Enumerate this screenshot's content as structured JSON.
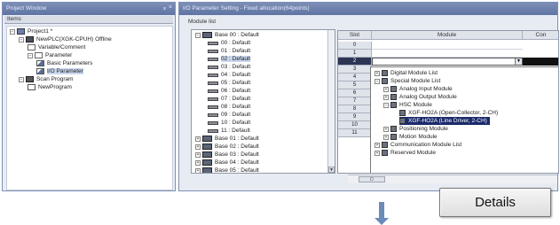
{
  "project_window": {
    "title": "Project Window",
    "pin": "ᵩ",
    "close": "×",
    "items_header": "Items",
    "tree": [
      {
        "label": "Project1 *",
        "indent": 0,
        "icon": "project",
        "expander": "−"
      },
      {
        "label": "NewPLC(XGK-CPUH) Offline",
        "indent": 1,
        "icon": "plc",
        "expander": "−"
      },
      {
        "label": "Variable/Comment",
        "indent": 2,
        "icon": "doc",
        "expander": ""
      },
      {
        "label": "Parameter",
        "indent": 2,
        "icon": "doc",
        "expander": "−"
      },
      {
        "label": "Basic Parameters",
        "indent": 3,
        "icon": "settings",
        "expander": ""
      },
      {
        "label": "I/O Parameter",
        "indent": 3,
        "icon": "settings",
        "expander": "",
        "selected": true
      },
      {
        "label": "Scan Program",
        "indent": 1,
        "icon": "scan",
        "expander": "−"
      },
      {
        "label": "NewProgram",
        "indent": 2,
        "icon": "program",
        "expander": ""
      }
    ]
  },
  "io_window": {
    "title": "I/O Parameter Setting - Fixed allocation(64points)",
    "module_list_label": "Module list",
    "base_tree": [
      {
        "label": "Base 00 : Default",
        "type": "base",
        "expander": "−"
      },
      {
        "label": "00 : Default",
        "type": "slot"
      },
      {
        "label": "01 : Default",
        "type": "slot"
      },
      {
        "label": "02 : Default",
        "type": "slot"
      },
      {
        "label": "03 : Default",
        "type": "slot"
      },
      {
        "label": "04 : Default",
        "type": "slot"
      },
      {
        "label": "05 : Default",
        "type": "slot"
      },
      {
        "label": "06 : Default",
        "type": "slot"
      },
      {
        "label": "07 : Default",
        "type": "slot"
      },
      {
        "label": "08 : Default",
        "type": "slot"
      },
      {
        "label": "09 : Default",
        "type": "slot"
      },
      {
        "label": "10 : Default",
        "type": "slot"
      },
      {
        "label": "11 : Default",
        "type": "slot"
      },
      {
        "label": "Base 01 : Default",
        "type": "base",
        "expander": "+"
      },
      {
        "label": "Base 02 : Default",
        "type": "base",
        "expander": "+"
      },
      {
        "label": "Base 03 : Default",
        "type": "base",
        "expander": "+"
      },
      {
        "label": "Base 04 : Default",
        "type": "base",
        "expander": "+"
      },
      {
        "label": "Base 05 : Default",
        "type": "base",
        "expander": "+"
      }
    ],
    "grid": {
      "headers": [
        "Slot",
        "Module",
        "Con"
      ],
      "slots": [
        "0",
        "1",
        "2",
        "3",
        "4",
        "5",
        "6",
        "7",
        "8",
        "9",
        "10",
        "11"
      ],
      "selected_slot": "2"
    },
    "module_dropdown": [
      {
        "label": "Digital Module List",
        "indent": 0,
        "expander": "+"
      },
      {
        "label": "Special Module List",
        "indent": 0,
        "expander": "−"
      },
      {
        "label": "Analog Input Module",
        "indent": 1,
        "expander": "+"
      },
      {
        "label": "Analog Output Module",
        "indent": 1,
        "expander": "+"
      },
      {
        "label": "HSC Module",
        "indent": 1,
        "expander": "−"
      },
      {
        "label": "XGF-HO2A (Open-Collector, 2-CH)",
        "indent": 2,
        "expander": ""
      },
      {
        "label": "XGF-HO2A (Line Driver, 2-CH)",
        "indent": 2,
        "expander": "",
        "highlighted": true
      },
      {
        "label": "Positioning Module",
        "indent": 1,
        "expander": "+"
      },
      {
        "label": "Motion Module",
        "indent": 1,
        "expander": "+"
      },
      {
        "label": "Communication Module List",
        "indent": 0,
        "expander": "+"
      },
      {
        "label": "Reserved Module",
        "indent": 0,
        "expander": "+"
      }
    ],
    "bottom_button": "D"
  },
  "details_button": {
    "label": "Details"
  },
  "colors": {
    "title_bar": "#6a7fa8",
    "selection": "#1a2a6a",
    "arrow": "#6b8bb8"
  }
}
